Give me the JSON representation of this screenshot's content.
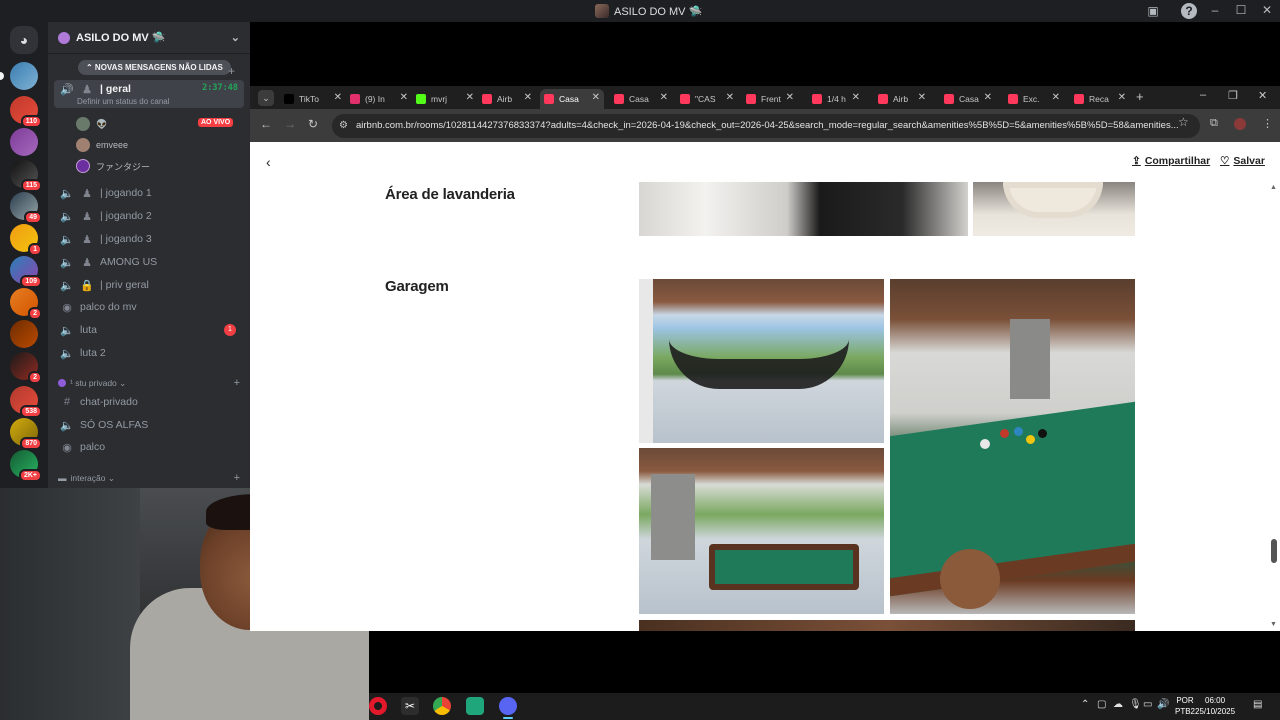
{
  "discord": {
    "window_title": "ASILO DO MV 🛸",
    "server_name": "ASILO DO MV 🛸",
    "new_messages_banner": "⌃ NOVAS MENSAGENS NÃO LIDAS",
    "rail_badges": [
      "110",
      "115",
      "49",
      "1",
      "109",
      "2",
      "2",
      "538",
      "870",
      "2K+"
    ],
    "active_channel": {
      "name": "| geral",
      "timer": "2:37:48",
      "status_hint": "Definir um status do canal"
    },
    "voice_users": [
      {
        "name": "👽",
        "live": "AO VIVO"
      },
      {
        "name": "emveee"
      },
      {
        "name": "ファンタジー"
      }
    ],
    "channels": [
      {
        "name": "| jogando 1"
      },
      {
        "name": "| jogando 2"
      },
      {
        "name": "| jogando 3"
      },
      {
        "name": "AMONG US"
      },
      {
        "name": "| priv geral"
      },
      {
        "name": "palco do mv"
      },
      {
        "name": "luta",
        "unread": "1"
      },
      {
        "name": "luta 2"
      }
    ],
    "category_private": "¹ stu privado ⌄",
    "private_channels": [
      {
        "name": "chat-privado"
      },
      {
        "name": "SÓ OS ALFAS"
      },
      {
        "name": "palco"
      }
    ],
    "category_interaction": "interação ⌄"
  },
  "browser": {
    "tabs": [
      {
        "label": "TikTo",
        "color": "#000000"
      },
      {
        "label": "(9) In",
        "color": "#e1306c"
      },
      {
        "label": "mvrj",
        "color": "#53fc18"
      },
      {
        "label": "Airb",
        "color": "#ff385c"
      },
      {
        "label": "Casa",
        "color": "#ff385c",
        "active": true
      },
      {
        "label": "Casa",
        "color": "#ff385c"
      },
      {
        "label": "\"CAS",
        "color": "#ff385c"
      },
      {
        "label": "Frent",
        "color": "#ff385c"
      },
      {
        "label": "1/4 h",
        "color": "#ff385c"
      },
      {
        "label": "Airb",
        "color": "#ff385c"
      },
      {
        "label": "Casa",
        "color": "#ff385c"
      },
      {
        "label": "Exc.",
        "color": "#ff385c"
      },
      {
        "label": "Reca",
        "color": "#ff385c"
      }
    ],
    "url": "airbnb.com.br/rooms/1028114427376833374?adults=4&check_in=2026-04-19&check_out=2026-04-25&search_mode=regular_search&amenities%5B%5D=5&amenities%5B%5D=58&amenities..."
  },
  "page": {
    "share_label": "Compartilhar",
    "save_label": "Salvar",
    "section_laundry": "Área de lavanderia",
    "section_garage": "Garagem"
  },
  "taskbar": {
    "lang_top": "POR",
    "lang_bottom": "PTB2",
    "time": "06:00",
    "date": "25/10/2025"
  }
}
